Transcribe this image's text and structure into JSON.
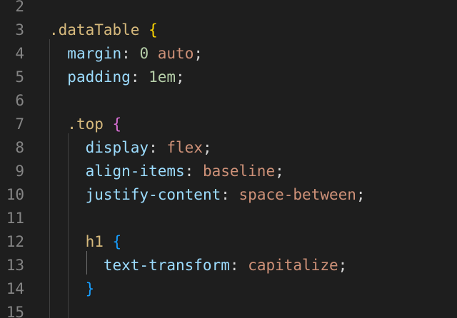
{
  "editor": {
    "lines": [
      {
        "num": "2",
        "segments": []
      },
      {
        "num": "3",
        "segments": [
          {
            "text": ".dataTable",
            "cls": "c-sel"
          },
          {
            "text": " ",
            "cls": "c-punc"
          },
          {
            "text": "{",
            "cls": "c-b1"
          }
        ]
      },
      {
        "num": "4",
        "segments": [
          {
            "text": "  ",
            "cls": "c-punc"
          },
          {
            "text": "margin",
            "cls": "c-prop"
          },
          {
            "text": ": ",
            "cls": "c-punc"
          },
          {
            "text": "0",
            "cls": "c-num"
          },
          {
            "text": " ",
            "cls": "c-punc"
          },
          {
            "text": "auto",
            "cls": "c-val"
          },
          {
            "text": ";",
            "cls": "c-punc"
          }
        ]
      },
      {
        "num": "5",
        "segments": [
          {
            "text": "  ",
            "cls": "c-punc"
          },
          {
            "text": "padding",
            "cls": "c-prop"
          },
          {
            "text": ": ",
            "cls": "c-punc"
          },
          {
            "text": "1em",
            "cls": "c-num"
          },
          {
            "text": ";",
            "cls": "c-punc"
          }
        ]
      },
      {
        "num": "6",
        "segments": []
      },
      {
        "num": "7",
        "segments": [
          {
            "text": "  ",
            "cls": "c-punc"
          },
          {
            "text": ".top",
            "cls": "c-sel"
          },
          {
            "text": " ",
            "cls": "c-punc"
          },
          {
            "text": "{",
            "cls": "c-b2"
          }
        ]
      },
      {
        "num": "8",
        "segments": [
          {
            "text": "    ",
            "cls": "c-punc"
          },
          {
            "text": "display",
            "cls": "c-prop"
          },
          {
            "text": ": ",
            "cls": "c-punc"
          },
          {
            "text": "flex",
            "cls": "c-val"
          },
          {
            "text": ";",
            "cls": "c-punc"
          }
        ]
      },
      {
        "num": "9",
        "segments": [
          {
            "text": "    ",
            "cls": "c-punc"
          },
          {
            "text": "align-items",
            "cls": "c-prop"
          },
          {
            "text": ": ",
            "cls": "c-punc"
          },
          {
            "text": "baseline",
            "cls": "c-val"
          },
          {
            "text": ";",
            "cls": "c-punc"
          }
        ]
      },
      {
        "num": "10",
        "segments": [
          {
            "text": "    ",
            "cls": "c-punc"
          },
          {
            "text": "justify-content",
            "cls": "c-prop"
          },
          {
            "text": ": ",
            "cls": "c-punc"
          },
          {
            "text": "space-between",
            "cls": "c-val"
          },
          {
            "text": ";",
            "cls": "c-punc"
          }
        ]
      },
      {
        "num": "11",
        "segments": []
      },
      {
        "num": "12",
        "segments": [
          {
            "text": "    ",
            "cls": "c-punc"
          },
          {
            "text": "h1",
            "cls": "c-sel"
          },
          {
            "text": " ",
            "cls": "c-punc"
          },
          {
            "text": "{",
            "cls": "c-b3"
          }
        ]
      },
      {
        "num": "13",
        "segments": [
          {
            "text": "      ",
            "cls": "c-punc"
          },
          {
            "text": "text-transform",
            "cls": "c-prop"
          },
          {
            "text": ": ",
            "cls": "c-punc"
          },
          {
            "text": "capitalize",
            "cls": "c-val"
          },
          {
            "text": ";",
            "cls": "c-punc"
          }
        ]
      },
      {
        "num": "14",
        "segments": [
          {
            "text": "    ",
            "cls": "c-punc"
          },
          {
            "text": "}",
            "cls": "c-b3"
          }
        ]
      },
      {
        "num": "15",
        "segments": []
      }
    ]
  }
}
